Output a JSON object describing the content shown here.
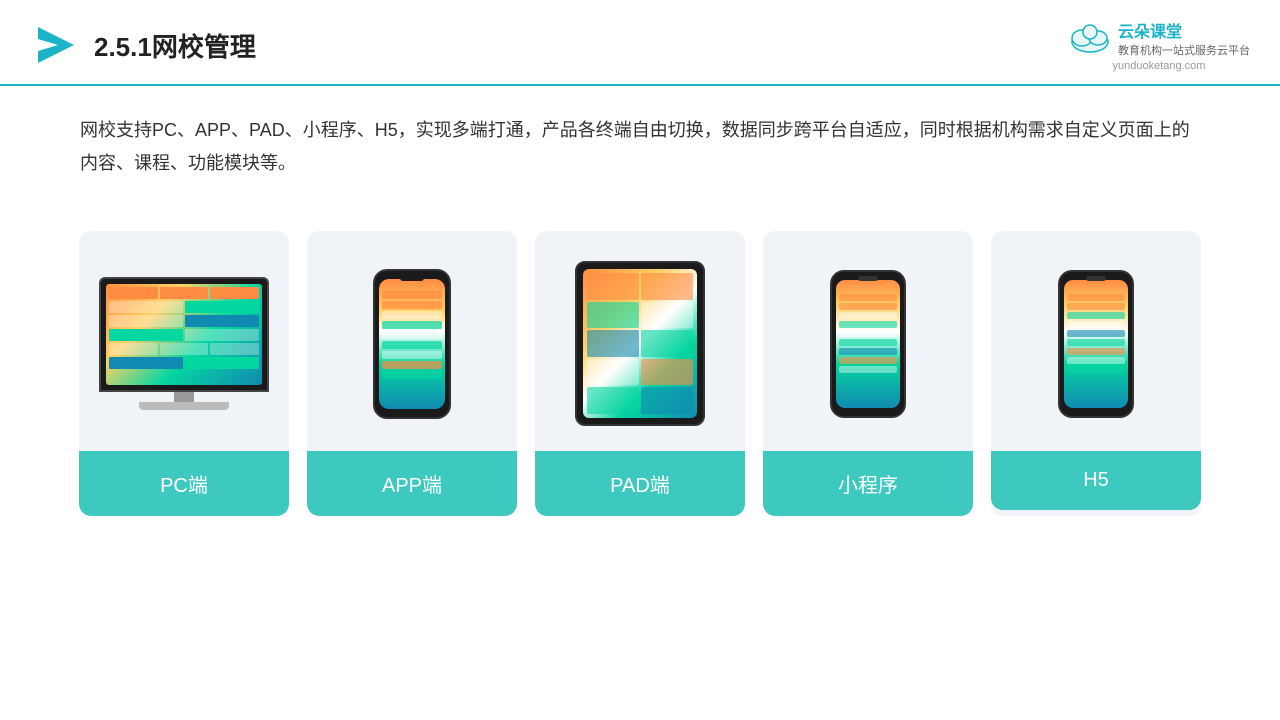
{
  "header": {
    "title": "2.5.1网校管理",
    "brand_name": "云朵课堂",
    "brand_tagline": "教育机构一站\n式服务云平台",
    "brand_url": "yunduoketang.com"
  },
  "description": {
    "text": "网校支持PC、APP、PAD、小程序、H5，实现多端打通，产品各终端自由切换，数据同步跨平台自适应，同时根据机构需求自定义页面上的内容、课程、功能模块等。"
  },
  "cards": [
    {
      "label": "PC端",
      "type": "pc"
    },
    {
      "label": "APP端",
      "type": "phone"
    },
    {
      "label": "PAD端",
      "type": "tablet"
    },
    {
      "label": "小程序",
      "type": "miniphone"
    },
    {
      "label": "H5",
      "type": "miniphone2"
    }
  ],
  "colors": {
    "accent": "#3dc8c0",
    "header_line": "#1ab3c8"
  }
}
